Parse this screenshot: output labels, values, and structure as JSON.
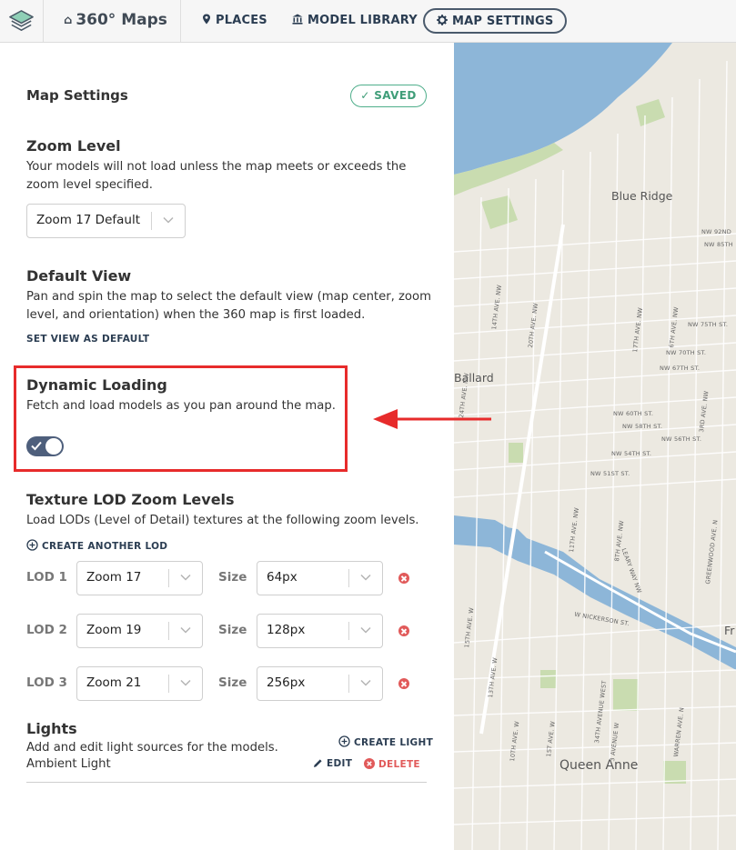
{
  "nav": {
    "brand": "360° Maps",
    "links": [
      {
        "label": "PLACES",
        "icon": "map-pin-icon"
      },
      {
        "label": "MODEL LIBRARY",
        "icon": "bank-icon"
      },
      {
        "label": "MAP SETTINGS",
        "icon": "gear-icon",
        "active": true
      }
    ]
  },
  "panel": {
    "title": "Map Settings",
    "saved_badge": "SAVED",
    "zoom": {
      "title": "Zoom Level",
      "description": "Your models will not load unless the map meets or exceeds the zoom level specified.",
      "selected": "Zoom 17 Default"
    },
    "default_view": {
      "title": "Default View",
      "description": "Pan and spin the map to select the default view (map center, zoom level, and orientation) when the 360 map is first loaded.",
      "action": "SET VIEW AS DEFAULT"
    },
    "dynamic_loading": {
      "title": "Dynamic Loading",
      "description": "Fetch and load models as you pan around the map.",
      "enabled": true
    },
    "texture_lod": {
      "title": "Texture LOD Zoom Levels",
      "description": "Load LODs (Level of Detail) textures at the following zoom levels.",
      "create_label": "CREATE ANOTHER LOD",
      "size_label": "Size",
      "rows": [
        {
          "label": "LOD 1",
          "zoom": "Zoom 17",
          "size": "64px"
        },
        {
          "label": "LOD 2",
          "zoom": "Zoom 19",
          "size": "128px"
        },
        {
          "label": "LOD 3",
          "zoom": "Zoom 21",
          "size": "256px"
        }
      ]
    },
    "lights": {
      "title": "Lights",
      "description": "Add and edit light sources for the models.",
      "create_label": "CREATE LIGHT",
      "items": [
        {
          "name": "Ambient Light",
          "edit": "EDIT",
          "delete": "DELETE"
        }
      ]
    }
  },
  "map": {
    "places": [
      "Blue Ridge",
      "Ballard",
      "Queen Anne",
      "Fr"
    ],
    "streets": [
      "NW 92ND",
      "NW 85TH",
      "NW 75TH ST.",
      "NW 70TH ST.",
      "NW 67TH ST.",
      "NW 60TH ST.",
      "NW 58TH ST.",
      "NW 56TH ST.",
      "NW 54TH ST.",
      "NW 51ST ST.",
      "W NICKERSON ST.",
      "24TH AVE. NW",
      "20TH AVE. NW",
      "17TH AVE. NW",
      "14TH AVE. NW",
      "11TH AVE. NW",
      "8TH AVE. NW",
      "6TH AVE. NW",
      "3RD AVE. NW",
      "LEARY WAY NW",
      "GREENWOOD AVE. N",
      "15TH AVE. W",
      "13TH AVE. W",
      "10TH AVE. W",
      "3 AVENUE W",
      "1ST AVE. W",
      "WARREN AVE. N",
      "34TH AVENUE WEST"
    ]
  },
  "colors": {
    "accent": "#2b3d52",
    "saved_green": "#3f9d78",
    "delete_red": "#e15a5a",
    "highlight_red": "#e72b2b",
    "water": "#8db6d8",
    "park": "#c9dcb0",
    "land": "#ece9e1"
  }
}
